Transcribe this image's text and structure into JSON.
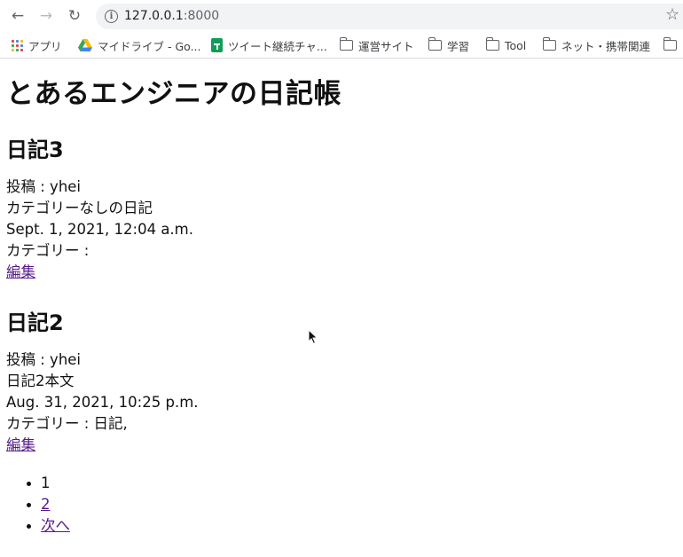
{
  "browser": {
    "url_host": "127.0.0.1",
    "url_port": ":8000",
    "bookmarks": [
      {
        "label": "アプリ",
        "icon": "apps-icon"
      },
      {
        "label": "マイドライブ - Go...",
        "icon": "google-drive-icon"
      },
      {
        "label": "ツイート継続チャ...",
        "icon": "google-sheets-icon"
      },
      {
        "label": "運営サイト",
        "icon": "folder-icon"
      },
      {
        "label": "学習",
        "icon": "folder-icon"
      },
      {
        "label": "Tool",
        "icon": "folder-icon"
      },
      {
        "label": "ネット・携帯関連",
        "icon": "folder-icon"
      }
    ]
  },
  "page": {
    "title": "とあるエンジニアの日記帳",
    "entries": [
      {
        "title": "日記3",
        "author": "投稿 : yhei",
        "body": "カテゴリーなしの日記",
        "date": "Sept. 1, 2021, 12:04 a.m.",
        "categories": "カテゴリー :",
        "edit_label": "編集"
      },
      {
        "title": "日記2",
        "author": "投稿 : yhei",
        "body": "日記2本文",
        "date": "Aug. 31, 2021, 10:25 p.m.",
        "categories": "カテゴリー : 日記,",
        "edit_label": "編集"
      }
    ],
    "pagination": {
      "current": "1",
      "page2": "2",
      "next_label": "次へ"
    }
  }
}
